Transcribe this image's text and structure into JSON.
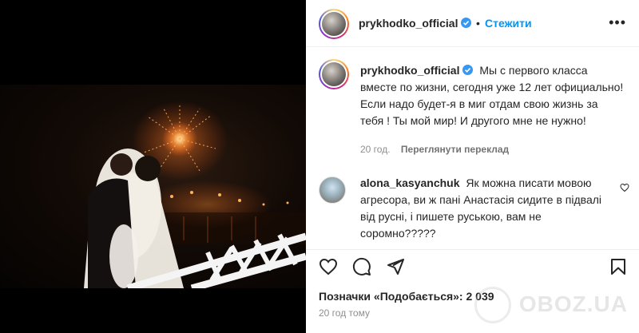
{
  "post": {
    "author": "prykhodko_official",
    "follow_label": "Стежити",
    "separator": "•",
    "caption": "Мы с первого класса вместе по жизни, сегодня уже 12 лет официально! Если надо будет-я в миг отдам свою жизнь за тебя ! Ты мой мир! И другого мне не нужно!",
    "caption_age": "20 год.",
    "translate_label": "Переглянути переклад"
  },
  "comment": {
    "author": "alona_kasyanchuk",
    "text": "Як можна писати мовою агресора, ви ж пані Анастасія сидите в підвалі від русні, і пишете руською, вам не соромно?????"
  },
  "footer": {
    "likes_label": "Позначки «Подобається»: 2 039",
    "time_ago": "20 год тому"
  },
  "watermark": "OBOZ.UA",
  "icons": {
    "verified": "verified-badge-icon",
    "more": "more-options-icon",
    "like": "heart-icon",
    "comment": "comment-icon",
    "share": "share-icon",
    "save": "bookmark-icon"
  },
  "colors": {
    "accent": "#0095f6",
    "verified": "#3897f0",
    "muted": "#8e8e8e"
  }
}
